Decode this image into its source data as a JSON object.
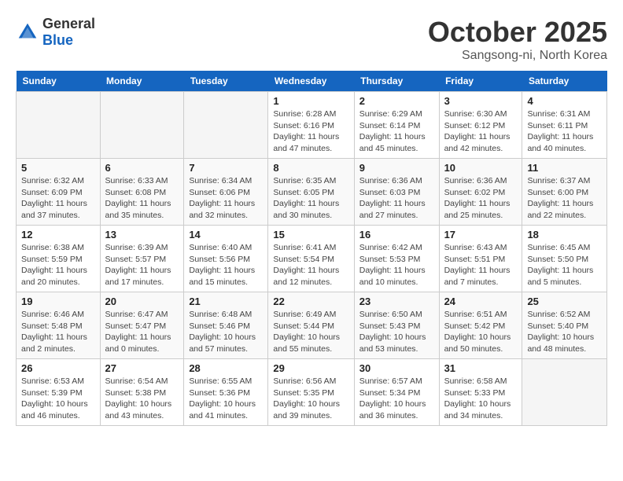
{
  "header": {
    "logo_general": "General",
    "logo_blue": "Blue",
    "month": "October 2025",
    "location": "Sangsong-ni, North Korea"
  },
  "weekdays": [
    "Sunday",
    "Monday",
    "Tuesday",
    "Wednesday",
    "Thursday",
    "Friday",
    "Saturday"
  ],
  "weeks": [
    [
      {
        "day": "",
        "detail": ""
      },
      {
        "day": "",
        "detail": ""
      },
      {
        "day": "",
        "detail": ""
      },
      {
        "day": "1",
        "detail": "Sunrise: 6:28 AM\nSunset: 6:16 PM\nDaylight: 11 hours\nand 47 minutes."
      },
      {
        "day": "2",
        "detail": "Sunrise: 6:29 AM\nSunset: 6:14 PM\nDaylight: 11 hours\nand 45 minutes."
      },
      {
        "day": "3",
        "detail": "Sunrise: 6:30 AM\nSunset: 6:12 PM\nDaylight: 11 hours\nand 42 minutes."
      },
      {
        "day": "4",
        "detail": "Sunrise: 6:31 AM\nSunset: 6:11 PM\nDaylight: 11 hours\nand 40 minutes."
      }
    ],
    [
      {
        "day": "5",
        "detail": "Sunrise: 6:32 AM\nSunset: 6:09 PM\nDaylight: 11 hours\nand 37 minutes."
      },
      {
        "day": "6",
        "detail": "Sunrise: 6:33 AM\nSunset: 6:08 PM\nDaylight: 11 hours\nand 35 minutes."
      },
      {
        "day": "7",
        "detail": "Sunrise: 6:34 AM\nSunset: 6:06 PM\nDaylight: 11 hours\nand 32 minutes."
      },
      {
        "day": "8",
        "detail": "Sunrise: 6:35 AM\nSunset: 6:05 PM\nDaylight: 11 hours\nand 30 minutes."
      },
      {
        "day": "9",
        "detail": "Sunrise: 6:36 AM\nSunset: 6:03 PM\nDaylight: 11 hours\nand 27 minutes."
      },
      {
        "day": "10",
        "detail": "Sunrise: 6:36 AM\nSunset: 6:02 PM\nDaylight: 11 hours\nand 25 minutes."
      },
      {
        "day": "11",
        "detail": "Sunrise: 6:37 AM\nSunset: 6:00 PM\nDaylight: 11 hours\nand 22 minutes."
      }
    ],
    [
      {
        "day": "12",
        "detail": "Sunrise: 6:38 AM\nSunset: 5:59 PM\nDaylight: 11 hours\nand 20 minutes."
      },
      {
        "day": "13",
        "detail": "Sunrise: 6:39 AM\nSunset: 5:57 PM\nDaylight: 11 hours\nand 17 minutes."
      },
      {
        "day": "14",
        "detail": "Sunrise: 6:40 AM\nSunset: 5:56 PM\nDaylight: 11 hours\nand 15 minutes."
      },
      {
        "day": "15",
        "detail": "Sunrise: 6:41 AM\nSunset: 5:54 PM\nDaylight: 11 hours\nand 12 minutes."
      },
      {
        "day": "16",
        "detail": "Sunrise: 6:42 AM\nSunset: 5:53 PM\nDaylight: 11 hours\nand 10 minutes."
      },
      {
        "day": "17",
        "detail": "Sunrise: 6:43 AM\nSunset: 5:51 PM\nDaylight: 11 hours\nand 7 minutes."
      },
      {
        "day": "18",
        "detail": "Sunrise: 6:45 AM\nSunset: 5:50 PM\nDaylight: 11 hours\nand 5 minutes."
      }
    ],
    [
      {
        "day": "19",
        "detail": "Sunrise: 6:46 AM\nSunset: 5:48 PM\nDaylight: 11 hours\nand 2 minutes."
      },
      {
        "day": "20",
        "detail": "Sunrise: 6:47 AM\nSunset: 5:47 PM\nDaylight: 11 hours\nand 0 minutes."
      },
      {
        "day": "21",
        "detail": "Sunrise: 6:48 AM\nSunset: 5:46 PM\nDaylight: 10 hours\nand 57 minutes."
      },
      {
        "day": "22",
        "detail": "Sunrise: 6:49 AM\nSunset: 5:44 PM\nDaylight: 10 hours\nand 55 minutes."
      },
      {
        "day": "23",
        "detail": "Sunrise: 6:50 AM\nSunset: 5:43 PM\nDaylight: 10 hours\nand 53 minutes."
      },
      {
        "day": "24",
        "detail": "Sunrise: 6:51 AM\nSunset: 5:42 PM\nDaylight: 10 hours\nand 50 minutes."
      },
      {
        "day": "25",
        "detail": "Sunrise: 6:52 AM\nSunset: 5:40 PM\nDaylight: 10 hours\nand 48 minutes."
      }
    ],
    [
      {
        "day": "26",
        "detail": "Sunrise: 6:53 AM\nSunset: 5:39 PM\nDaylight: 10 hours\nand 46 minutes."
      },
      {
        "day": "27",
        "detail": "Sunrise: 6:54 AM\nSunset: 5:38 PM\nDaylight: 10 hours\nand 43 minutes."
      },
      {
        "day": "28",
        "detail": "Sunrise: 6:55 AM\nSunset: 5:36 PM\nDaylight: 10 hours\nand 41 minutes."
      },
      {
        "day": "29",
        "detail": "Sunrise: 6:56 AM\nSunset: 5:35 PM\nDaylight: 10 hours\nand 39 minutes."
      },
      {
        "day": "30",
        "detail": "Sunrise: 6:57 AM\nSunset: 5:34 PM\nDaylight: 10 hours\nand 36 minutes."
      },
      {
        "day": "31",
        "detail": "Sunrise: 6:58 AM\nSunset: 5:33 PM\nDaylight: 10 hours\nand 34 minutes."
      },
      {
        "day": "",
        "detail": ""
      }
    ]
  ]
}
